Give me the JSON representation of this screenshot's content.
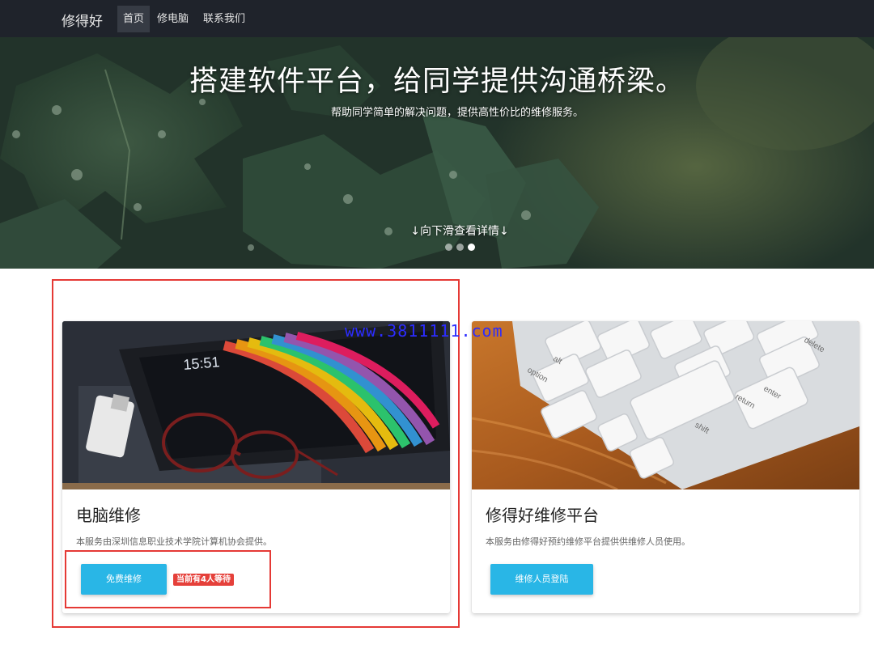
{
  "nav": {
    "brand": "修得好",
    "items": [
      {
        "label": "首页",
        "active": true
      },
      {
        "label": "修电脑",
        "active": false
      },
      {
        "label": "联系我们",
        "active": false
      }
    ]
  },
  "hero": {
    "title": "搭建软件平台，给同学提供沟通桥梁。",
    "subtitle": "帮助同学简单的解决问题，提供高性价比的维修服务。",
    "scroll_hint": "↓向下滑查看详情↓",
    "carousel": {
      "count": 3,
      "active_index": 2
    }
  },
  "cards": [
    {
      "title": "电脑维修",
      "description": "本服务由深圳信息职业技术学院计算机协会提供。",
      "button": "免费维修",
      "badge": "当前有4人等待",
      "image_icon": "tablet-laptop-photo",
      "tablet_time": "15:51"
    },
    {
      "title": "修得好维修平台",
      "description": "本服务由修得好预约维修平台提供供维修人员使用。",
      "button": "维修人员登陆",
      "image_icon": "keyboard-photo",
      "keys": [
        "delete",
        "enter",
        "return",
        "shift",
        "option",
        "alt"
      ]
    }
  ],
  "watermark": "www.3811111.com",
  "colors": {
    "navbar": "#1f232b",
    "button": "#29b6e6",
    "badge": "#e5403a",
    "highlight": "#e53935"
  }
}
